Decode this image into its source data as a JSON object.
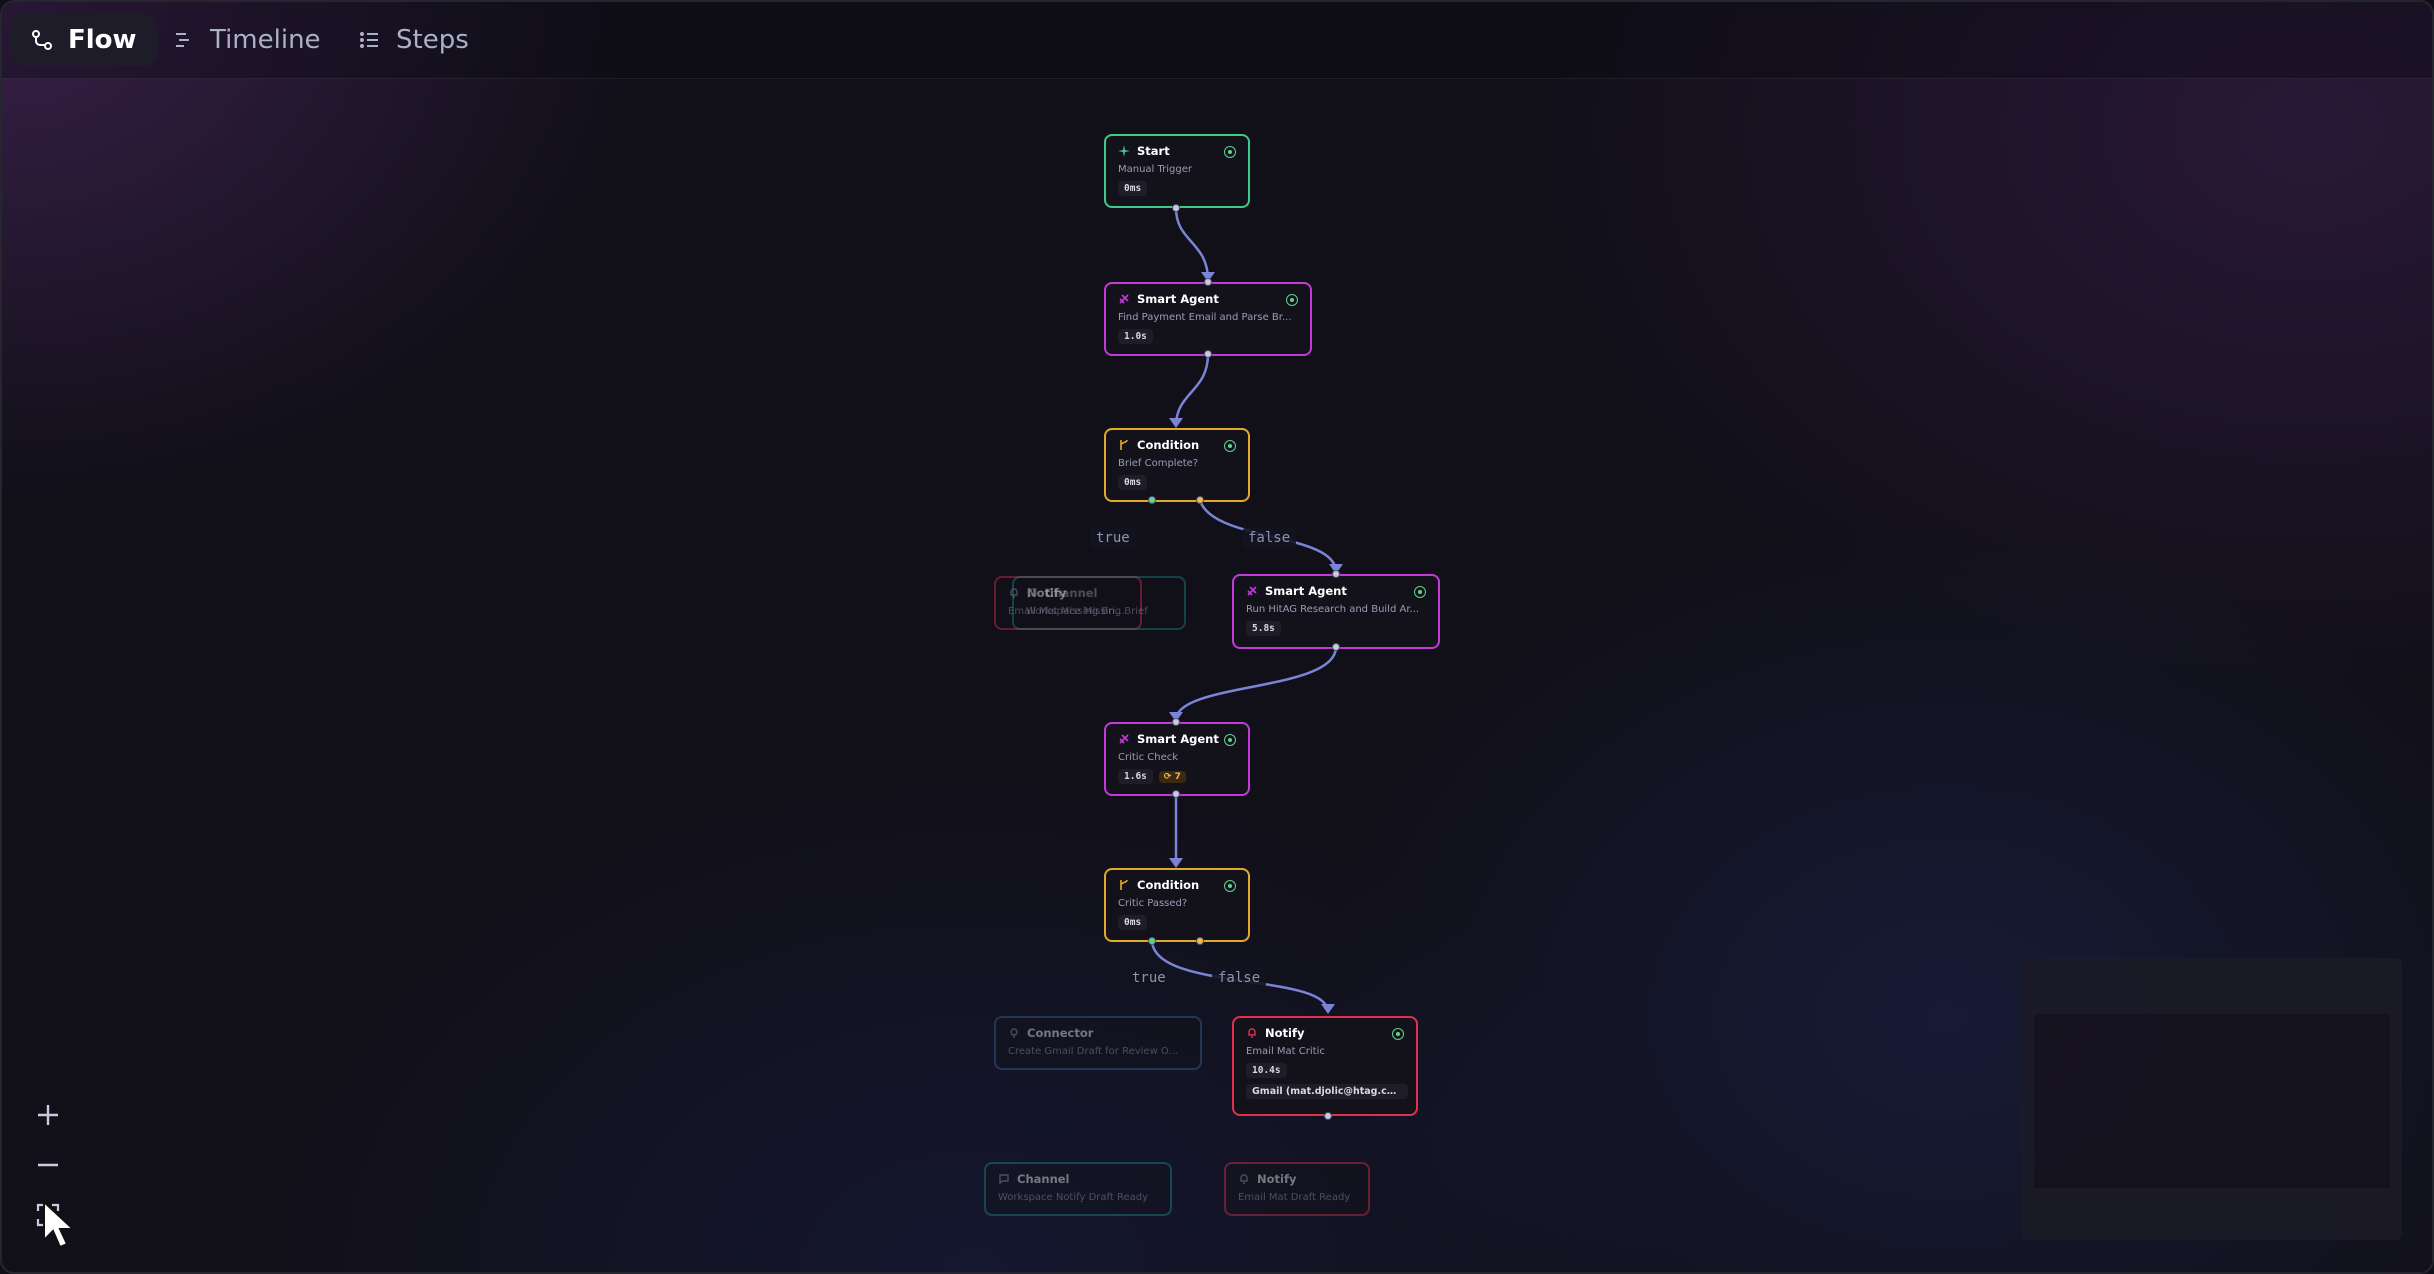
{
  "tabs": [
    {
      "label": "Flow",
      "icon": "flow-icon",
      "active": true
    },
    {
      "label": "Timeline",
      "icon": "timeline-icon",
      "active": false
    },
    {
      "label": "Steps",
      "icon": "steps-icon",
      "active": false
    }
  ],
  "nodes": {
    "start": {
      "type": "Start",
      "subtitle": "Manual Trigger",
      "duration": "0ms",
      "icon": "sparkle-icon",
      "status": "success"
    },
    "agent1": {
      "type": "Smart Agent",
      "subtitle": "Find Payment Email and Parse Br...",
      "duration": "1.0s",
      "icon": "agent-icon",
      "status": "success"
    },
    "cond1": {
      "type": "Condition",
      "subtitle": "Brief Complete?",
      "duration": "0ms",
      "icon": "branch-icon",
      "status": "success"
    },
    "notify_dim": {
      "type": "Notify",
      "subtitle": "Email Mat Missing Briefing"
    },
    "channel_dim": {
      "type": "Channel",
      "subtitle": "Workspace Missing Brief"
    },
    "agent2": {
      "type": "Smart Agent",
      "subtitle": "Run HitAG Research and Build Ar...",
      "duration": "5.8s",
      "icon": "agent-icon",
      "status": "success"
    },
    "agent3": {
      "type": "Smart Agent",
      "subtitle": "Critic Check",
      "duration": "1.6s",
      "badge": "7",
      "icon": "agent-icon",
      "status": "success"
    },
    "cond2": {
      "type": "Condition",
      "subtitle": "Critic Passed?",
      "duration": "0ms",
      "icon": "branch-icon",
      "status": "success"
    },
    "connector": {
      "type": "Connector",
      "subtitle": "Create Gmail Draft for Review O..."
    },
    "notify_main": {
      "type": "Notify",
      "subtitle": "Email Mat Critic",
      "duration": "10.4s",
      "detail": "Gmail (mat.djolic@htag.com...",
      "icon": "bell-icon",
      "status": "success"
    },
    "channel2": {
      "type": "Channel",
      "subtitle": "Workspace Notify Draft Ready"
    },
    "notify3": {
      "type": "Notify",
      "subtitle": "Email Mat Draft Ready"
    }
  },
  "edge_labels": {
    "c1_true": "true",
    "c1_false": "false",
    "c2_true": "true",
    "c2_false": "false"
  },
  "zoom_controls": {
    "zoom_in": "+",
    "zoom_out": "—"
  },
  "colors": {
    "start": "#3fc98a",
    "agent": "#c23ad8",
    "condition": "#e3a92a",
    "notify": "#e0304f",
    "channel": "#1f8a8a",
    "connector": "#3a6a9a",
    "edge": "#7a84d6"
  }
}
